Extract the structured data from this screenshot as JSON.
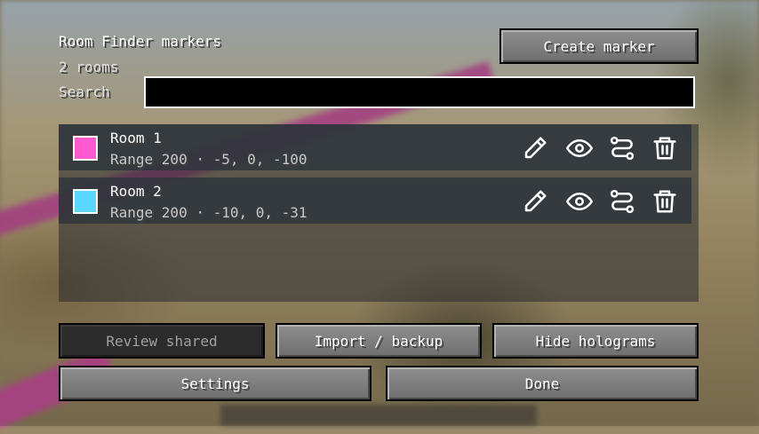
{
  "header": {
    "title": "Room Finder markers",
    "count": "2 rooms",
    "search_label": "Search",
    "search_value": "",
    "create_button": "Create marker"
  },
  "markers": [
    {
      "name": "Room 1",
      "detail": "Range 200 · -5, 0, -100",
      "color": "#ff5ad2"
    },
    {
      "name": "Room 2",
      "detail": "Range 200 · -10, 0, -31",
      "color": "#5ad8ff"
    }
  ],
  "row_icons": [
    "pencil-icon",
    "eye-icon",
    "route-icon",
    "trash-icon"
  ],
  "footer": {
    "review_shared": "Review shared",
    "import_backup": "Import / backup",
    "hide_holograms": "Hide holograms",
    "settings": "Settings",
    "done": "Done"
  }
}
